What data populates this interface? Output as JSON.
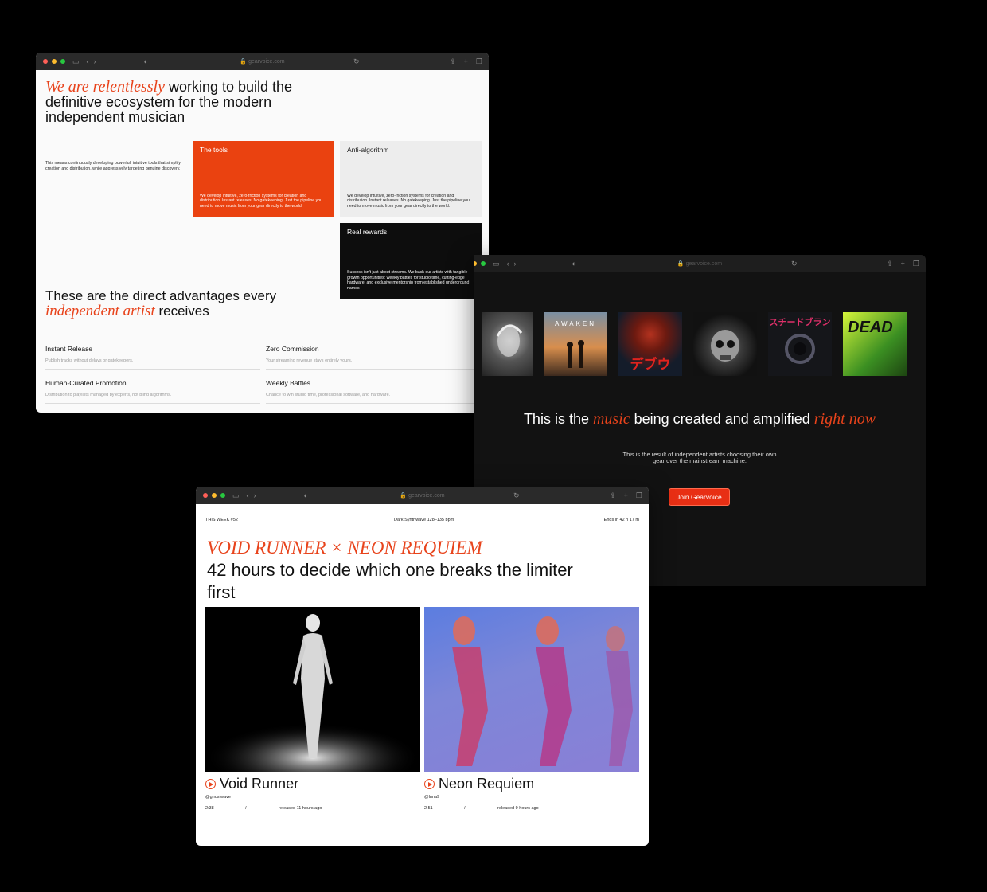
{
  "browser": {
    "url": "gearvoice.com"
  },
  "window1": {
    "headline_italic": "We are relentlessly",
    "headline_rest": " working to build the definitive ecosystem for the modern independent musician",
    "intro": "This means continuously developing powerful, intuitive tools that simplify creation and distribution, while aggressively targeting genuine discovery.",
    "cards": [
      {
        "title": "The tools",
        "body": "We develop intuitive, zero-friction systems for creation and distribution. Instant releases. No gatekeeping. Just the pipeline you need to move music from your gear directly to the world."
      },
      {
        "title": "Anti-algorithm",
        "body": "We develop intuitive, zero-friction systems for creation and distribution. Instant releases. No gatekeeping. Just the pipeline you need to move music from your gear directly to the world."
      },
      {
        "title": "Real rewards",
        "body": "Success isn't just about streams. We back our artists with tangible growth opportunities: weekly battles for studio time, cutting-edge hardware, and exclusive mentorship from established underground names"
      }
    ],
    "advantages_a": "These are the direct advantages every ",
    "advantages_italic": "independent artist",
    "advantages_b": " receives",
    "benefits": [
      {
        "title": "Instant Release",
        "desc": "Publish tracks without delays or gatekeepers."
      },
      {
        "title": "Zero Commission",
        "desc": "Your streaming revenue stays entirely yours."
      },
      {
        "title": "Human-Curated Promotion",
        "desc": "Distribution to playlists managed by experts, not blind algorithms."
      },
      {
        "title": "Weekly Battles",
        "desc": "Chance to win studio time, professional software, and hardware."
      }
    ]
  },
  "window2": {
    "tag_a": "This is the ",
    "tag_italic1": "music",
    "tag_b": " being created and amplified ",
    "tag_italic2": "right now",
    "sub": "This is the result of independent artists choosing their own gear over the mainstream machine.",
    "cta": "Join Gearvoice",
    "album_texts": {
      "awaken": "AWAKEN",
      "red_moon": "デブウ",
      "katakana": "スチードブラン",
      "dead": "DEAD"
    }
  },
  "window3": {
    "week": "THIS WEEK #52",
    "genre": "Dark Synthwave 128–135 bpm",
    "ends": "Ends in 42 h 17 m",
    "versus": "VOID RUNNER × NEON REQUIEM",
    "headline": "42 hours to decide which one breaks the limiter first",
    "tracks": [
      {
        "name": "Void Runner",
        "handle": "@ghostwave",
        "duration": "2:38",
        "sep": "/",
        "released": "released 11 hours ago"
      },
      {
        "name": "Neon Requiem",
        "handle": "@luna9",
        "duration": "2:51",
        "sep": "/",
        "released": "released 9 hours ago"
      }
    ]
  },
  "colors": {
    "accent": "#e8431b",
    "cta": "#e82f14",
    "dark_bg": "#121212"
  }
}
